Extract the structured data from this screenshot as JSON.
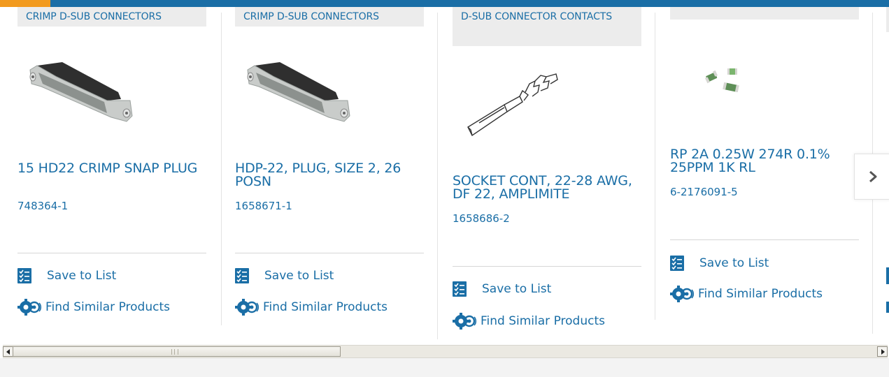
{
  "products": [
    {
      "category": "CRIMP D-SUB CONNECTORS",
      "title": "15 HD22 CRIMP SNAP PLUG",
      "part_number": "748364-1",
      "image": "d-sub-plug-image"
    },
    {
      "category": "CRIMP D-SUB CONNECTORS",
      "title": "HDP-22, PLUG, SIZE 2, 26 POSN",
      "part_number": "1658671-1",
      "image": "d-sub-plug-image"
    },
    {
      "category": "D-SUB CONNECTOR CONTACTS",
      "title": "SOCKET CONT, 22-28 AWG, DF 22, AMPLIMITE",
      "part_number": "1658686-2",
      "image": "socket-contact-image"
    },
    {
      "category": "",
      "title": "RP 2A 0.25W 274R 0.1% 25PPM 1K RL",
      "part_number": "6-2176091-5",
      "image": "chip-resistor-image"
    }
  ],
  "actions": {
    "save_label": "Save to List",
    "similar_label": "Find Similar Products"
  },
  "icons": {
    "save": "checklist-icon",
    "similar": "gears-icon",
    "next": "chevron-right-icon"
  },
  "colors": {
    "link": "#1a6ea6",
    "category_bg": "#ececec",
    "top_bar": "#1a6ea6",
    "top_bar_accent": "#f29a1e"
  }
}
